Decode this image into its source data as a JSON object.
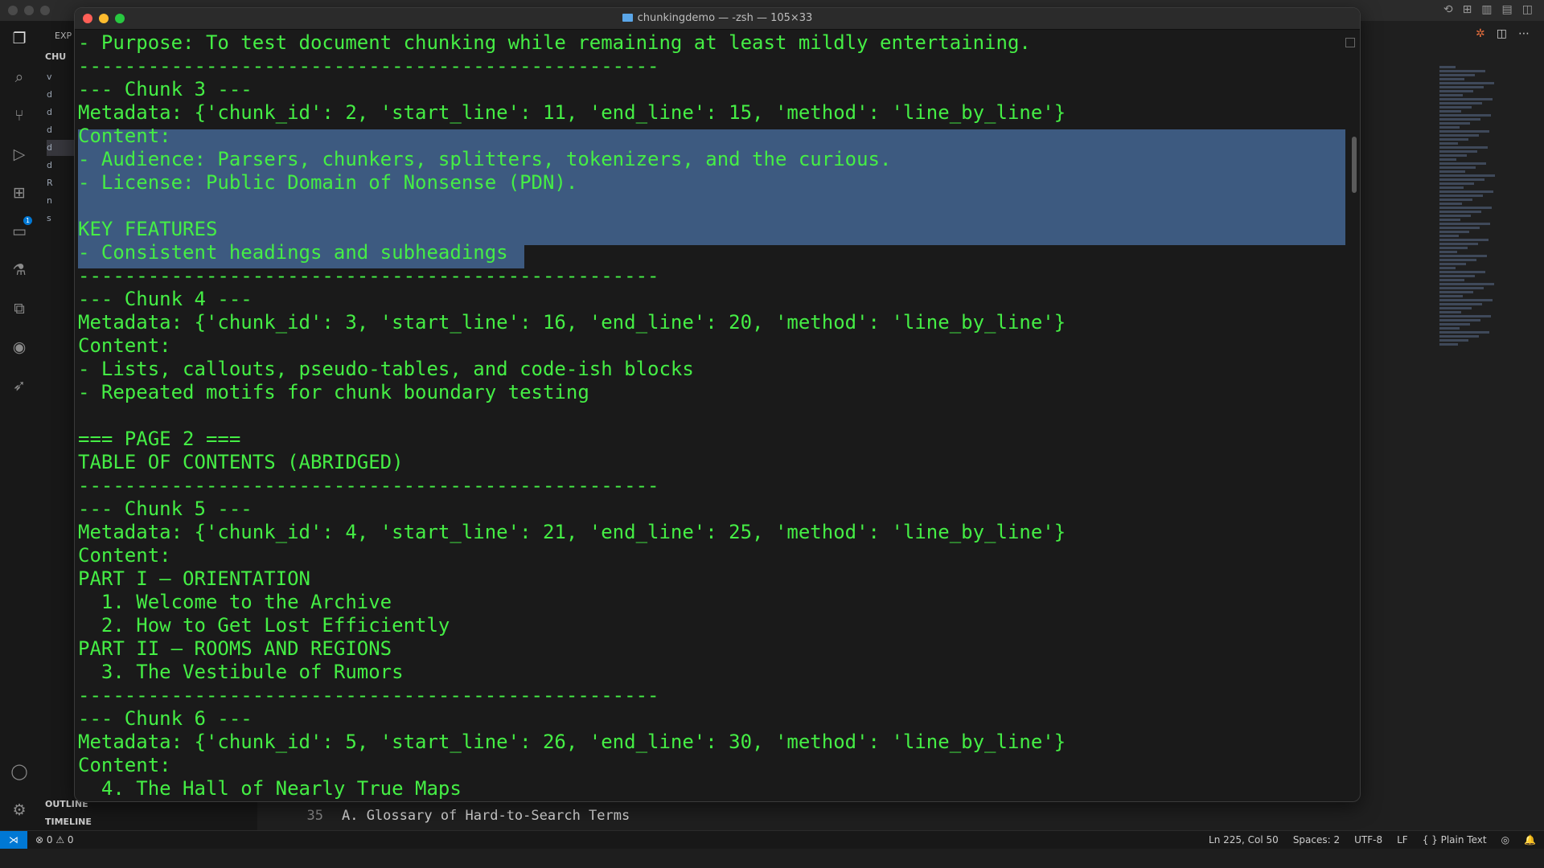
{
  "terminal": {
    "title": "chunkingdemo — -zsh — 105×33",
    "lines": [
      "- Purpose: To test document chunking while remaining at least mildly entertaining.",
      "--------------------------------------------------",
      "--- Chunk 3 ---",
      "Metadata: {'chunk_id': 2, 'start_line': 11, 'end_line': 15, 'method': 'line_by_line'}",
      "Content:",
      "- Audience: Parsers, chunkers, splitters, tokenizers, and the curious.",
      "- License: Public Domain of Nonsense (PDN).",
      "",
      "KEY FEATURES",
      "- Consistent headings and subheadings",
      "--------------------------------------------------",
      "--- Chunk 4 ---",
      "Metadata: {'chunk_id': 3, 'start_line': 16, 'end_line': 20, 'method': 'line_by_line'}",
      "Content:",
      "- Lists, callouts, pseudo-tables, and code-ish blocks",
      "- Repeated motifs for chunk boundary testing",
      "",
      "=== PAGE 2 ===",
      "TABLE OF CONTENTS (ABRIDGED)",
      "--------------------------------------------------",
      "--- Chunk 5 ---",
      "Metadata: {'chunk_id': 4, 'start_line': 21, 'end_line': 25, 'method': 'line_by_line'}",
      "Content:",
      "PART I — ORIENTATION",
      "  1. Welcome to the Archive",
      "  2. How to Get Lost Efficiently",
      "PART II — ROOMS AND REGIONS",
      "  3. The Vestibule of Rumors",
      "--------------------------------------------------",
      "--- Chunk 6 ---",
      "Metadata: {'chunk_id': 5, 'start_line': 26, 'end_line': 30, 'method': 'line_by_line'}",
      "Content:",
      "  4. The Hall of Nearly True Maps"
    ]
  },
  "sidebar": {
    "header": "EXP",
    "folder": "CHU",
    "file_letters": [
      "v",
      "d",
      "d",
      "d",
      "d",
      "d",
      "R",
      "n",
      "s"
    ],
    "outline_label": "OUTLINE",
    "timeline_label": "TIMELINE"
  },
  "activity_bar": {
    "icons": [
      "files-icon",
      "search-icon",
      "source-control-icon",
      "run-debug-icon",
      "extensions-icon",
      "remote-explorer-icon",
      "testing-icon",
      "references-icon",
      "copilot-icon",
      "deploy-icon",
      "account-icon",
      "settings-gear-icon"
    ],
    "extensions_badge": "1"
  },
  "editor": {
    "visible_line_number": "35",
    "visible_line_text": "A. Glossary of Hard-to-Search Terms"
  },
  "status_bar": {
    "errors": "0",
    "warnings": "0",
    "cursor": "Ln 225, Col 50",
    "spaces": "Spaces: 2",
    "encoding": "UTF-8",
    "eol": "LF",
    "language": "Plain Text"
  },
  "colors": {
    "terminal_text": "#45ee45",
    "selection": "#3d5a80",
    "accent": "#0078d4"
  }
}
